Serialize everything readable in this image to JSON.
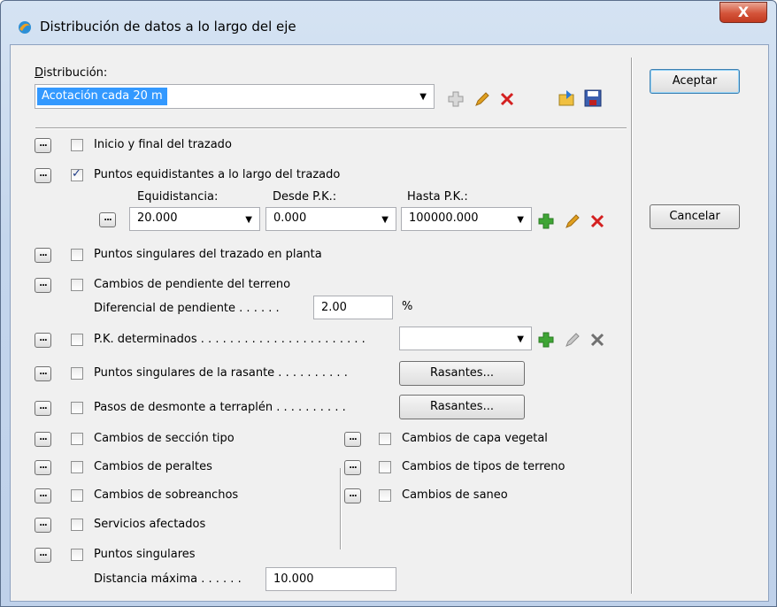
{
  "window": {
    "title": "Distribución de datos a lo largo del eje",
    "close_label": "X"
  },
  "distribution": {
    "label": "Distribución:",
    "selected": "Acotación cada 20 m"
  },
  "buttons": {
    "accept": "Aceptar",
    "cancel": "Cancelar"
  },
  "dots_label": "...",
  "options": {
    "inicio_final": {
      "label": "Inicio y final del trazado",
      "checked": false
    },
    "equidistantes": {
      "label": "Puntos equidistantes a lo largo del trazado",
      "checked": true
    },
    "singulares_planta": {
      "label": "Puntos singulares del trazado en planta",
      "checked": false
    },
    "cambios_pendiente": {
      "label": "Cambios de pendiente del terreno",
      "checked": false
    },
    "pk_determinados": {
      "label": "P.K. determinados . . . . . . . . . . . . . . . . . . . . . . .",
      "checked": false
    },
    "singulares_rasante": {
      "label": "Puntos singulares de la rasante . . . . . . . . . .",
      "checked": false
    },
    "pasos_desmonte": {
      "label": "Pasos de desmonte a terraplén . . . . . . . . . .",
      "checked": false
    },
    "seccion_tipo": {
      "label": "Cambios de sección tipo",
      "checked": false
    },
    "peraltes": {
      "label": "Cambios de peraltes",
      "checked": false
    },
    "sobreanchos": {
      "label": "Cambios de sobreanchos",
      "checked": false
    },
    "servicios": {
      "label": "Servicios afectados",
      "checked": false
    },
    "puntos_singulares": {
      "label": "Puntos singulares",
      "checked": false
    },
    "capa_vegetal": {
      "label": "Cambios de capa vegetal",
      "checked": false
    },
    "tipos_terreno": {
      "label": "Cambios de tipos de terreno",
      "checked": false
    },
    "saneo": {
      "label": "Cambios de saneo",
      "checked": false
    }
  },
  "equidistance": {
    "equidistancia_label": "Equidistancia:",
    "desde_label": "Desde P.K.:",
    "hasta_label": "Hasta P.K.:",
    "equidistancia_value": "20.000",
    "desde_value": "0.000",
    "hasta_value": "100000.000"
  },
  "pendiente": {
    "label": "Diferencial de pendiente . . . . . .",
    "value": "2.00",
    "unit": "%"
  },
  "pk_value": "",
  "rasantes_button": "Rasantes...",
  "distancia": {
    "label": "Distancia máxima . . . . . .",
    "value": "10.000"
  },
  "colors": {
    "selection": "#3399ff",
    "add": "#3fa535",
    "delete": "#d42020",
    "edit": "#e0a020"
  }
}
